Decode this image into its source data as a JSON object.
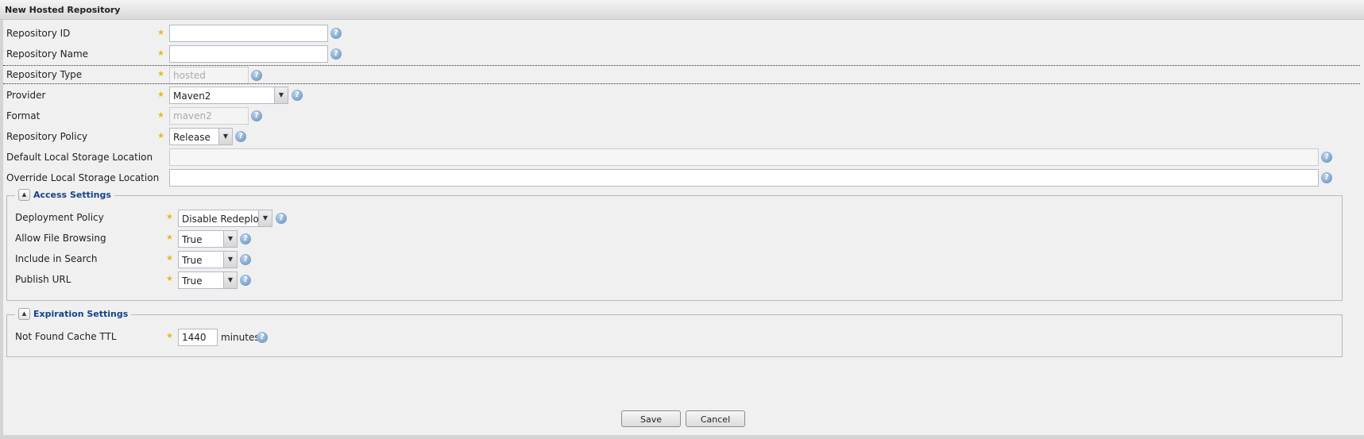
{
  "window": {
    "title": "New Hosted Repository"
  },
  "form": {
    "repository_id": {
      "label": "Repository ID",
      "value": ""
    },
    "repository_name": {
      "label": "Repository Name",
      "value": ""
    },
    "repository_type": {
      "label": "Repository Type",
      "value": "hosted"
    },
    "provider": {
      "label": "Provider",
      "value": "Maven2"
    },
    "format": {
      "label": "Format",
      "value": "maven2"
    },
    "repository_policy": {
      "label": "Repository Policy",
      "value": "Release"
    },
    "default_storage": {
      "label": "Default Local Storage Location",
      "value": ""
    },
    "override_storage": {
      "label": "Override Local Storage Location",
      "value": ""
    }
  },
  "access_settings": {
    "title": "Access Settings",
    "deployment_policy": {
      "label": "Deployment Policy",
      "value": "Disable Redeploy"
    },
    "allow_file_browsing": {
      "label": "Allow File Browsing",
      "value": "True"
    },
    "include_in_search": {
      "label": "Include in Search",
      "value": "True"
    },
    "publish_url": {
      "label": "Publish URL",
      "value": "True"
    }
  },
  "expiration_settings": {
    "title": "Expiration Settings",
    "not_found_cache_ttl": {
      "label": "Not Found Cache TTL",
      "value": "1440",
      "unit": "minutes"
    }
  },
  "buttons": {
    "save": "Save",
    "cancel": "Cancel"
  },
  "icons": {
    "required": "star-icon",
    "help": "question-circle-icon",
    "collapse": "chevron-up-icon",
    "dropdown": "chevron-down-icon"
  },
  "colors": {
    "legend": "#15428b",
    "required_star": "#e8b820",
    "help": "#5f88bb"
  }
}
